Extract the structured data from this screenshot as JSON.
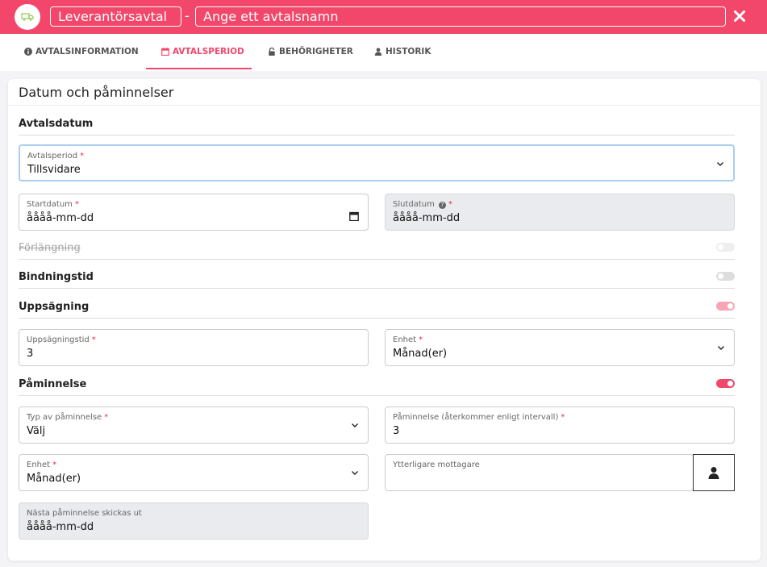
{
  "header": {
    "category_title": "Leverantörsavtal",
    "separator": "-",
    "name_placeholder": "Ange ett avtalsnamn",
    "close_glyph": "✕"
  },
  "tabs": [
    {
      "label": "AVTALSINFORMATION",
      "icon": "info-circle-icon",
      "active": false
    },
    {
      "label": "AVTALSPERIOD",
      "icon": "calendar-icon",
      "active": true
    },
    {
      "label": "BEHÖRIGHETER",
      "icon": "lock-icon",
      "active": false
    },
    {
      "label": "HISTORIK",
      "icon": "user-icon",
      "active": false
    }
  ],
  "card": {
    "title": "Datum och påminnelser",
    "sections": {
      "avtalsdatum": "Avtalsdatum",
      "forlangning": "Förlängning",
      "bindningstid": "Bindningstid",
      "uppsagning": "Uppsägning",
      "paminnelse": "Påminnelse"
    },
    "toggles": {
      "forlangning": false,
      "bindningstid": false,
      "uppsagning": true,
      "paminnelse": true
    },
    "fields": {
      "avtalsperiod": {
        "label": "Avtalsperiod",
        "required": "*",
        "value": "Tillsvidare"
      },
      "startdatum": {
        "label": "Startdatum",
        "required": "*",
        "value": "åååå-mm-dd"
      },
      "slutdatum": {
        "label": "Slutdatum",
        "required": "*",
        "value": "åååå-mm-dd",
        "help": "?"
      },
      "uppsagningstid": {
        "label": "Uppsägningstid",
        "required": "*",
        "value": "3"
      },
      "enhet_uppsagning": {
        "label": "Enhet",
        "required": "*",
        "value": "Månad(er)"
      },
      "typ_av_paminnelse": {
        "label": "Typ av påminnelse",
        "required": "*",
        "value": "Välj"
      },
      "paminnelse_intervall": {
        "label": "Påminnelse (återkommer enligt intervall)",
        "required": "*",
        "value": "3"
      },
      "enhet_paminnelse": {
        "label": "Enhet",
        "required": "*",
        "value": "Månad(er)"
      },
      "ytterligare_mottagare": {
        "label": "Ytterligare mottagare",
        "value": ""
      },
      "nasta_paminnelse": {
        "label": "Nästa påminnelse skickas ut",
        "value": "åååå-mm-dd"
      }
    }
  },
  "colors": {
    "accent": "#f2476a",
    "readonly_bg": "#e9ebee",
    "focus_border": "#a9cef0"
  }
}
